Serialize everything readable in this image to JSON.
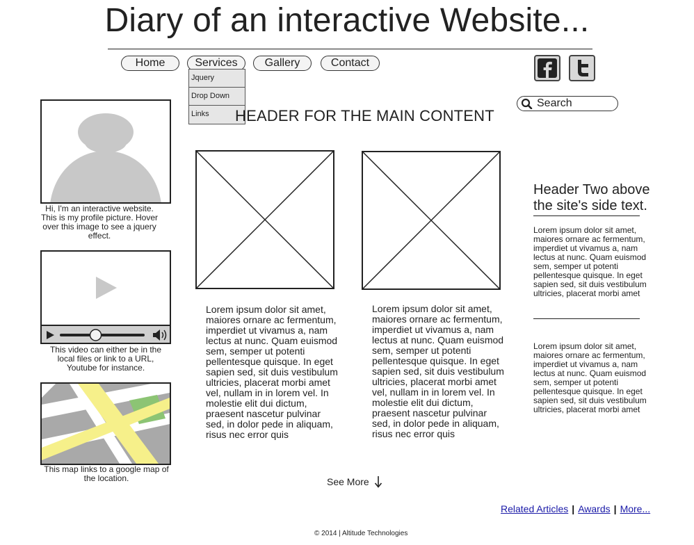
{
  "header": {
    "title": "Diary of an interactive Website..."
  },
  "nav": {
    "items": [
      {
        "label": "Home"
      },
      {
        "label": "Services"
      },
      {
        "label": "Gallery"
      },
      {
        "label": "Contact"
      }
    ],
    "dropdown": [
      "Jquery",
      "Drop Down",
      "Links"
    ]
  },
  "search": {
    "placeholder": "Search"
  },
  "main": {
    "header": "HEADER FOR THE MAIN CONTENT",
    "columns": [
      {
        "text": "Lorem ipsum dolor sit amet, maiores ornare ac fermentum, imperdiet ut vivamus a, nam lectus at nunc. Quam euismod sem, semper ut potenti pellentesque quisque. In eget sapien sed, sit duis vestibulum ultricies, placerat morbi amet vel, nullam in in lorem vel. In molestie elit dui dictum, praesent nascetur pulvinar sed, in dolor pede in aliquam, risus nec error quis"
      },
      {
        "text": "Lorem ipsum dolor sit amet, maiores ornare ac fermentum, imperdiet ut vivamus a, nam lectus at nunc. Quam euismod sem, semper ut potenti pellentesque quisque. In eget sapien sed, sit duis vestibulum ultricies, placerat morbi amet vel, nullam in in lorem vel. In molestie elit dui dictum, praesent nascetur pulvinar sed, in dolor pede in aliquam, risus nec error quis"
      }
    ],
    "see_more": "See More"
  },
  "left": {
    "profile_caption": "Hi, I'm an interactive website. This is my profile picture. Hover over this image to see a jquery effect.",
    "video_caption": "This video can either be in the local files or link to a URL, Youtube for instance.",
    "video_progress": 0.42,
    "map_caption": "This map links to a google map of the location."
  },
  "side": {
    "header": "Header Two above the site's side text.",
    "paragraphs": [
      "Lorem ipsum dolor sit amet, maiores ornare ac fermentum, imperdiet ut vivamus a, nam lectus at nunc. Quam euismod sem, semper ut potenti pellentesque quisque. In eget sapien sed, sit duis vestibulum ultricies, placerat morbi amet",
      "Lorem ipsum dolor sit amet, maiores ornare ac fermentum, imperdiet ut vivamus a, nam lectus at nunc. Quam euismod sem, semper ut potenti pellentesque quisque. In eget sapien sed, sit duis vestibulum ultricies, placerat morbi amet"
    ]
  },
  "footer": {
    "links": [
      "Related Articles",
      "Awards",
      "More..."
    ],
    "separator": "|",
    "copyright_symbol": "©",
    "copyright": "2014 | Altitude Technologies"
  },
  "icons": [
    "facebook-icon",
    "twitter-icon",
    "search-icon",
    "play-icon",
    "volume-icon",
    "arrow-down-icon"
  ],
  "colors": {
    "map_road": "#f6f08a",
    "map_park": "#8cc474",
    "map_bg": "#a9a9a9",
    "link": "#1a1aa8"
  }
}
